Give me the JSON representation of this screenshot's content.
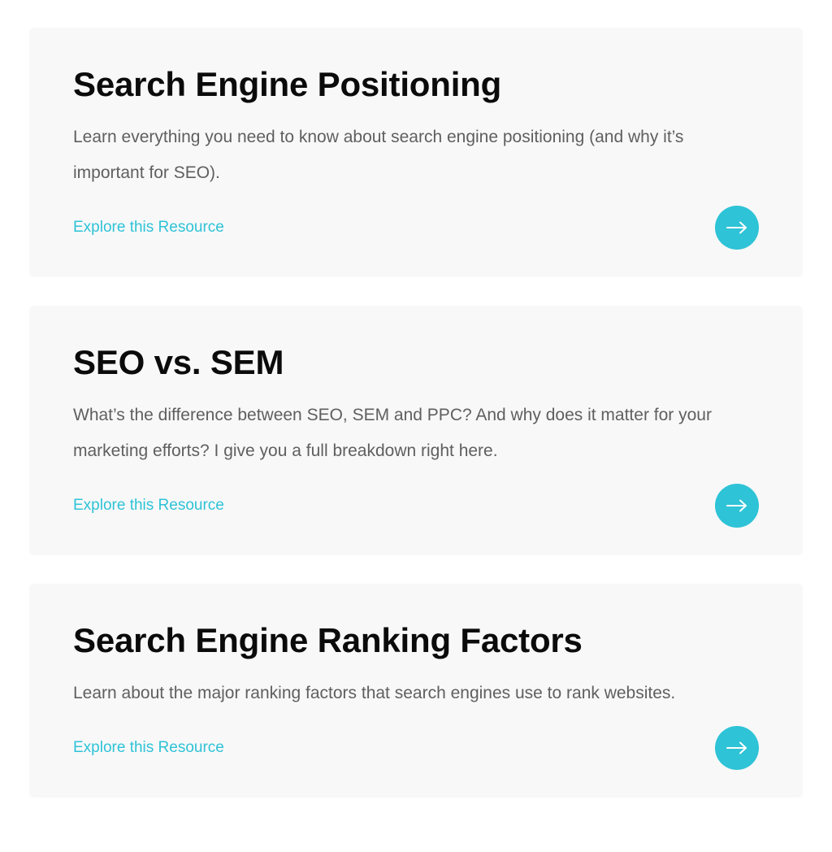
{
  "colors": {
    "accent": "#2ec3d6",
    "card_background": "#f8f8f9",
    "title_text": "#0b0b0b",
    "description_text": "#5f5f5f"
  },
  "cards": [
    {
      "title": "Search Engine Positioning",
      "description": "Learn everything you need to know about search engine positioning (and why it’s important for SEO).",
      "link_label": "Explore this Resource",
      "button_icon": "arrow-right-icon"
    },
    {
      "title": "SEO vs. SEM",
      "description": "What’s the difference between SEO, SEM and PPC? And why does it matter for your marketing efforts? I give you a full breakdown right here.",
      "link_label": "Explore this Resource",
      "button_icon": "arrow-right-icon"
    },
    {
      "title": "Search Engine Ranking Factors",
      "description": "Learn about the major ranking factors that search engines use to rank websites.",
      "link_label": "Explore this Resource",
      "button_icon": "arrow-right-icon"
    }
  ]
}
